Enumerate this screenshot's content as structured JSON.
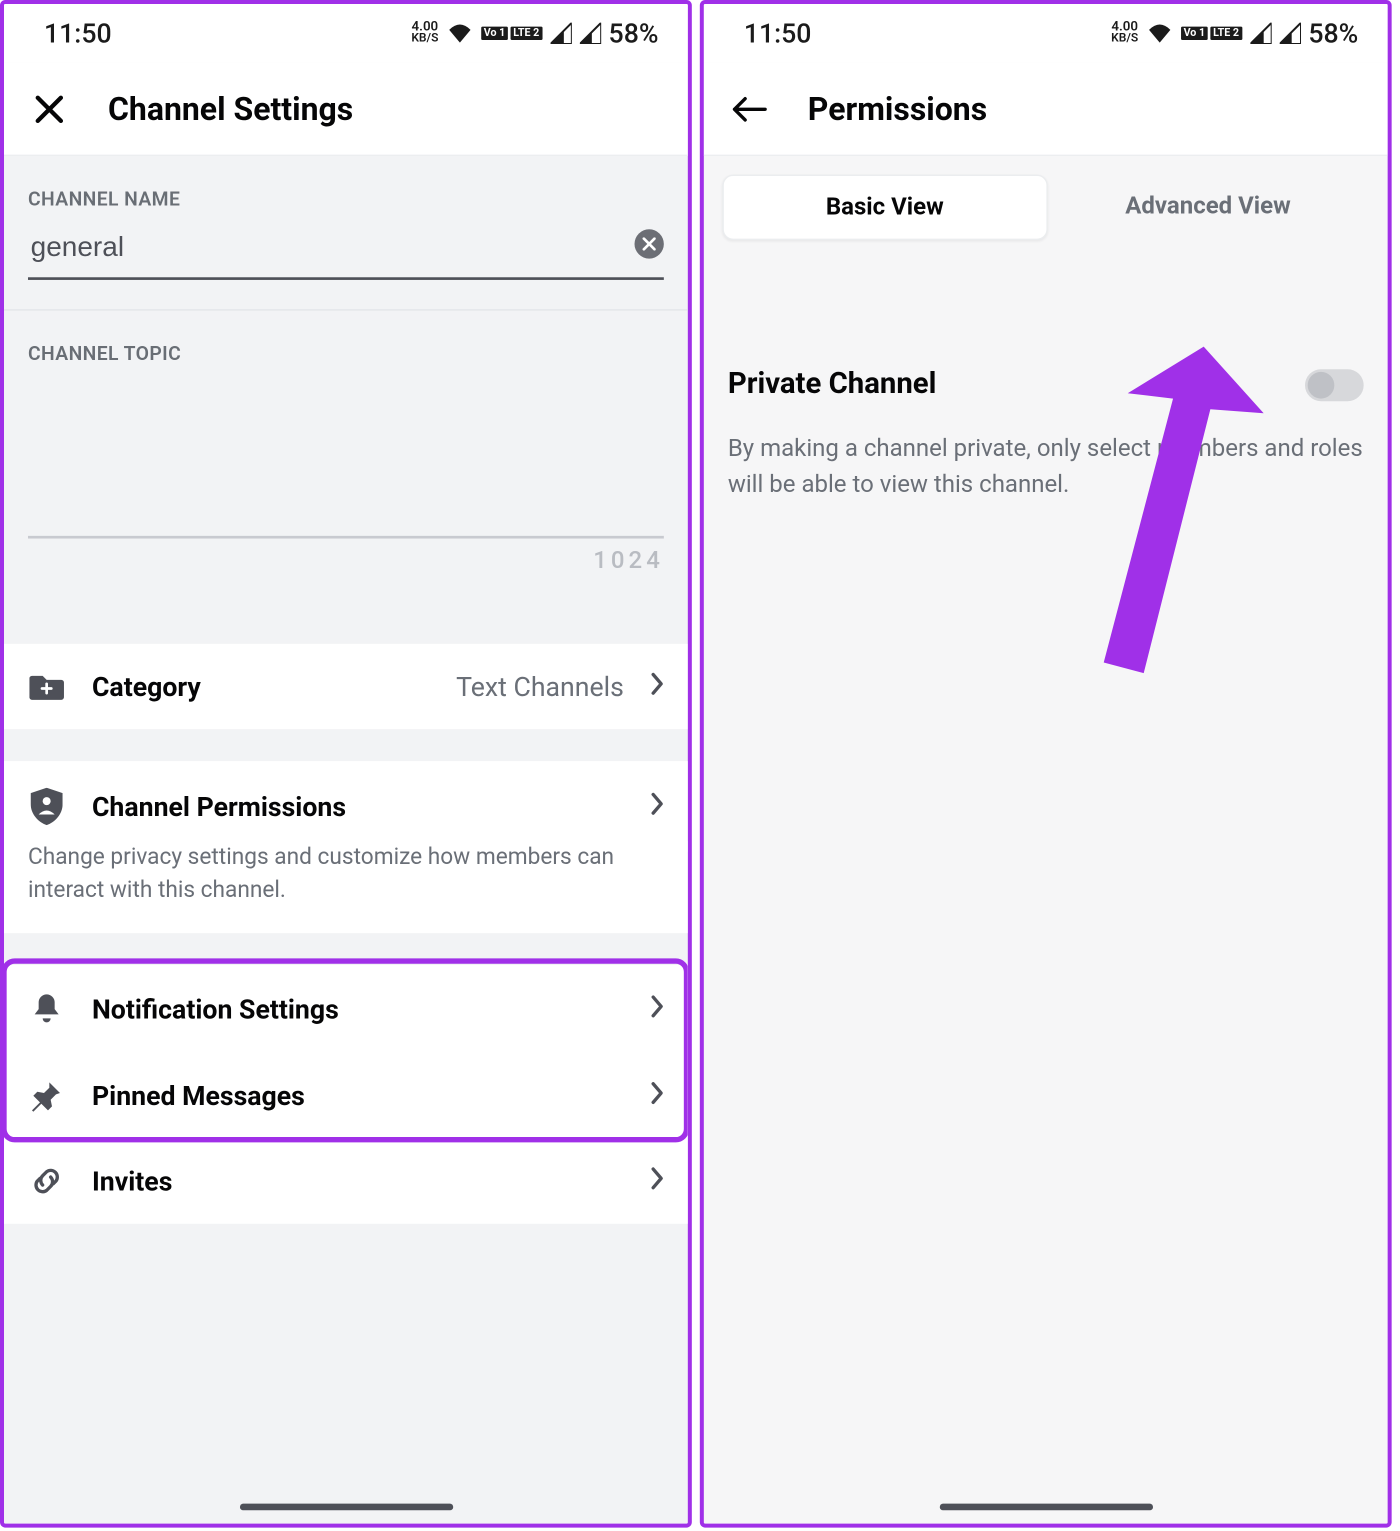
{
  "status": {
    "time": "11:50",
    "kbs_top": "4.00",
    "kbs_bot": "KB/S",
    "lte1": "Vo 1",
    "lte2": "LTE 2",
    "battery": "58%"
  },
  "left": {
    "title": "Channel Settings",
    "section_name": "CHANNEL NAME",
    "name_value": "general",
    "section_topic": "CHANNEL TOPIC",
    "char_count": "1024",
    "category": {
      "label": "Category",
      "value": "Text Channels"
    },
    "permissions": {
      "label": "Channel Permissions",
      "desc": "Change privacy settings and customize how members can interact with this channel."
    },
    "notifications": {
      "label": "Notification Settings"
    },
    "pinned": {
      "label": "Pinned Messages"
    },
    "invites": {
      "label": "Invites"
    }
  },
  "right": {
    "title": "Permissions",
    "tab_basic": "Basic View",
    "tab_advanced": "Advanced View",
    "private_title": "Private Channel",
    "private_desc": "By making a channel private, only select members and roles will be able to view this channel."
  }
}
